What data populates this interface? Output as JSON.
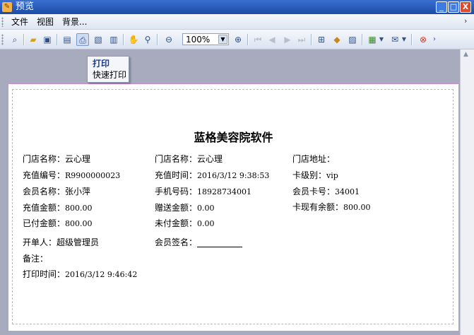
{
  "window": {
    "title": "预览",
    "controls": {
      "minimize": "_",
      "maximize": "□",
      "close": "X"
    }
  },
  "menu": {
    "items": [
      "文件",
      "视图",
      "背景..."
    ]
  },
  "toolbar": {
    "zoom_value": "100%"
  },
  "popup": {
    "items": [
      "打印",
      "快速打印"
    ]
  },
  "document": {
    "title": "蓝格美容院软件",
    "col1": [
      {
        "label": "门店名称：",
        "value": "云心理"
      },
      {
        "label": "充值编号：",
        "value": "R9900000023"
      },
      {
        "label": "会员名称：",
        "value": "张小萍"
      },
      {
        "label": "充值金额：",
        "value": "800.00"
      },
      {
        "label": "已付金额：",
        "value": "800.00"
      }
    ],
    "col2": [
      {
        "label": "门店名称：",
        "value": "云心理"
      },
      {
        "label": "充值时间：",
        "value": "2016/3/12 9:38:53"
      },
      {
        "label": "手机号码：",
        "value": "18928734001"
      },
      {
        "label": "赠送金额：",
        "value": "0.00"
      },
      {
        "label": "未付金额：",
        "value": "0.00"
      }
    ],
    "col3": [
      {
        "label": "门店地址：",
        "value": ""
      },
      {
        "label": "卡级别：",
        "value": "vip"
      },
      {
        "label": "会员卡号：",
        "value": "34001"
      },
      {
        "label": "卡现有余额：",
        "value": "800.00"
      }
    ],
    "operator": {
      "label": "开单人：",
      "value": "超级管理员"
    },
    "signature": {
      "label": "会员签名："
    },
    "remark": {
      "label": "备注："
    },
    "print_time": {
      "label": "打印时间：",
      "value": "2016/3/12 9:46:42"
    }
  },
  "colors": {
    "titlebar": "#1c4ba8",
    "workspace": "#a7abbd",
    "close_button": "#e04a2a"
  }
}
